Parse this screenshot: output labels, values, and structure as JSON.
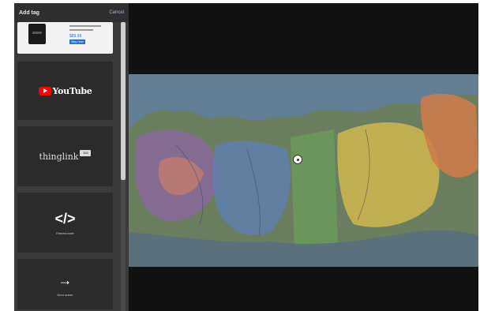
{
  "sidebar": {
    "title": "Add tag",
    "cancel_label": "Cancel",
    "cards": {
      "product": {
        "price": "$89.99",
        "button_label": "Buy now"
      },
      "youtube": {
        "icon": "youtube-logo-icon",
        "label": "YouTube"
      },
      "thinglink": {
        "label": "thinglink",
        "badge": "360"
      },
      "embed": {
        "icon": "code-icon",
        "glyph": "</>",
        "label": "Embed code"
      },
      "next": {
        "icon": "arrow-right-icon",
        "glyph": "→",
        "label": "Next scene"
      }
    }
  },
  "map": {
    "hotspot_icon": "hotspot-icon"
  },
  "colors": {
    "youtube_red": "#ff0000",
    "accent_blue": "#2a6fd6",
    "sidebar_bg": "#3a3a3a",
    "canvas_bg": "#121212"
  }
}
